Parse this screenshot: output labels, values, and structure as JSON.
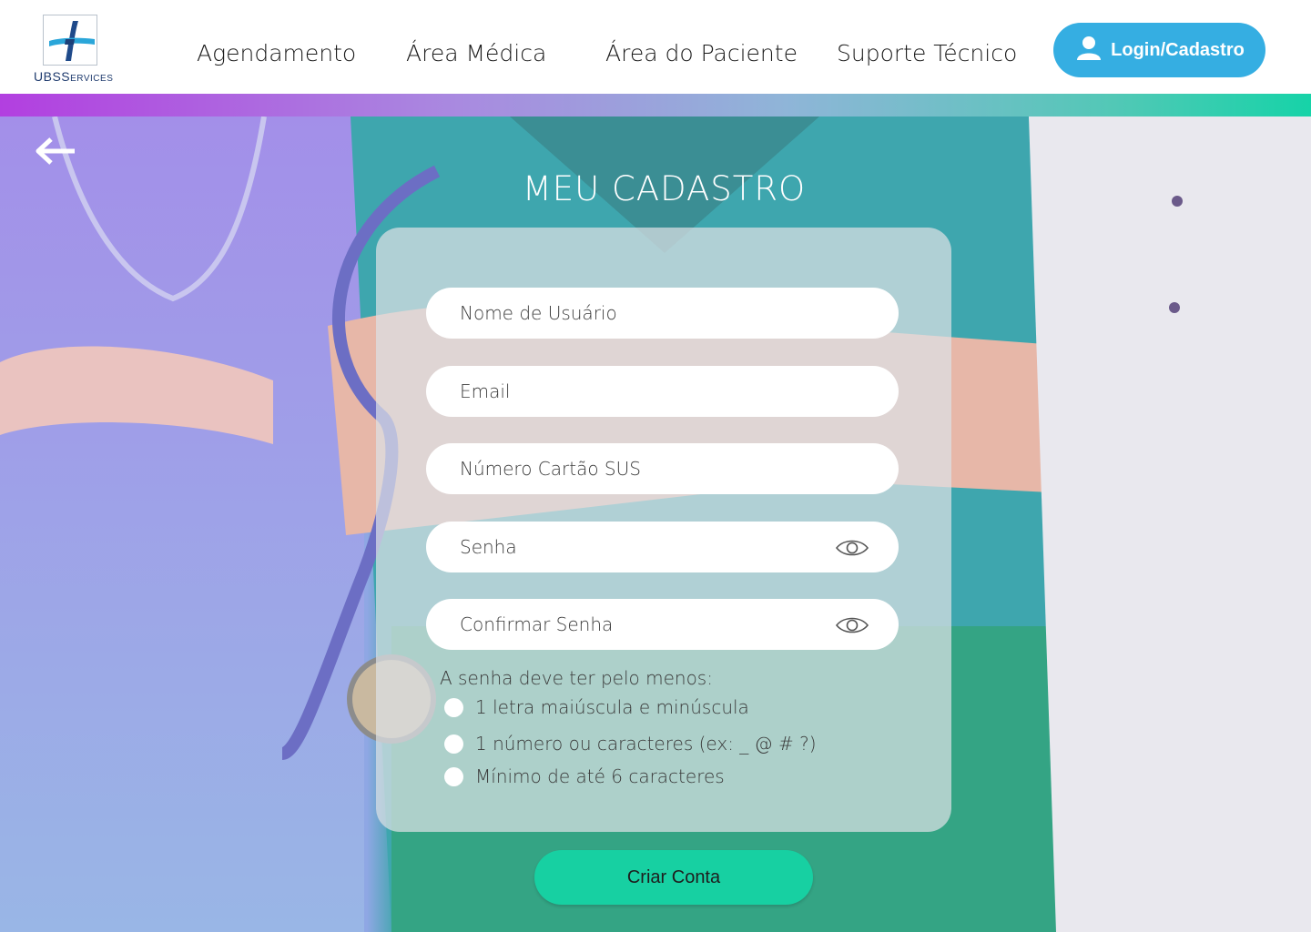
{
  "header": {
    "logo": {
      "text_main": "UBS",
      "text_small": "ERVICES",
      "text_prefix": "S"
    },
    "nav": [
      {
        "label": "Agendamento"
      },
      {
        "label": "Área Médica"
      },
      {
        "label": "Área do Paciente"
      },
      {
        "label": "Suporte Técnico"
      }
    ],
    "login_label": "Login/Cadastro"
  },
  "form": {
    "title": "MEU CADASTRO",
    "fields": [
      {
        "placeholder": "Nome de Usuário"
      },
      {
        "placeholder": "Email"
      },
      {
        "placeholder": "Número Cartão SUS"
      },
      {
        "placeholder": "Senha"
      },
      {
        "placeholder": "Confirmar Senha"
      }
    ],
    "password_rules": {
      "title": "A senha deve ter pelo menos:",
      "items": [
        {
          "label": "1 letra maiúscula e minúscula"
        },
        {
          "label": "1 número ou caracteres (ex: _ @ # ?)"
        },
        {
          "label": "Mínimo de até 6 caracteres"
        }
      ]
    },
    "submit_label": "Criar Conta"
  },
  "colors": {
    "accent_blue": "#35aee2",
    "accent_green": "#17d0a2",
    "gradient_start": "#b23fe0",
    "gradient_end": "#16d3a8"
  }
}
